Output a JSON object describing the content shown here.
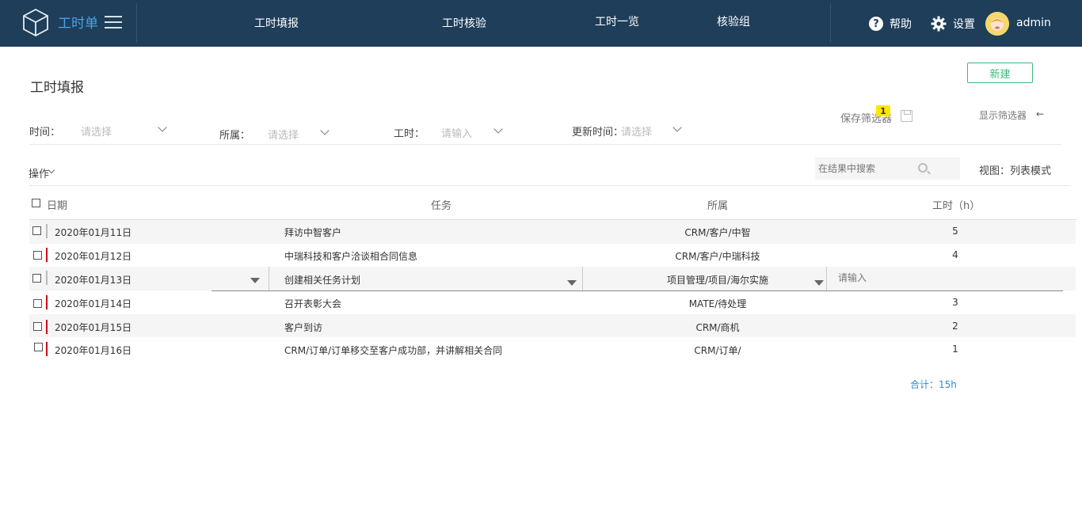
{
  "app": {
    "title": "工时单"
  },
  "nav": {
    "items": [
      {
        "label": "工时填报"
      },
      {
        "label": "工时核验"
      },
      {
        "label": "工时一览"
      },
      {
        "label": "核验组"
      }
    ]
  },
  "header_actions": {
    "help": "帮助",
    "settings": "设置",
    "user": "admin"
  },
  "page": {
    "title": "工时填报",
    "new_button": "新建",
    "save_filter": "保存筛选器",
    "save_filter_badge": "1",
    "show_filter": "显示筛选器",
    "show_filter_arrow": "←"
  },
  "filters": [
    {
      "label": "时间：",
      "placeholder": "请选择"
    },
    {
      "label": "所属：",
      "placeholder": "请选择"
    },
    {
      "label": "工时：",
      "placeholder": "请输入"
    },
    {
      "label": "更新时间：",
      "placeholder": "请选择"
    }
  ],
  "toolbar": {
    "operations": "操作",
    "search_placeholder": "在结果中搜索",
    "view_label": "视图：",
    "view_mode": "列表模式"
  },
  "table": {
    "columns": {
      "date": "日期",
      "task": "任务",
      "belongs": "所属",
      "hours": "工时（h）"
    },
    "rows": [
      {
        "date": "2020年01月11日",
        "task": "拜访中智客户",
        "belongs": "CRM/客户/中智",
        "hours": "5"
      },
      {
        "date": "2020年01月12日",
        "task": "中瑞科技和客户洽谈相合同信息",
        "belongs": "CRM/客户/中瑞科技",
        "hours": "4"
      },
      {
        "date": "2020年01月13日",
        "task": "创建相关任务计划",
        "belongs": "项目管理/项目/海尔实施",
        "hours_placeholder": "请输入"
      },
      {
        "date": "2020年01月14日",
        "task": "召开表彰大会",
        "belongs": "MATE/待处理",
        "hours": "3"
      },
      {
        "date": "2020年01月15日",
        "task": "客户到访",
        "belongs": "CRM/商机",
        "hours": "2"
      },
      {
        "date": "2020年01月16日",
        "task": "CRM/订单/订单移交至客户成功部，并讲解相关合同",
        "belongs": "CRM/订单/",
        "hours": "1"
      }
    ],
    "total": "合计：15h"
  },
  "colors": {
    "topbar": "#1e3e5a",
    "logo_text": "#4aa3e8",
    "new_button": "#3cb878",
    "row_marker": "#d0021b",
    "total": "#2b8dd6",
    "badge": "#ffe600"
  }
}
